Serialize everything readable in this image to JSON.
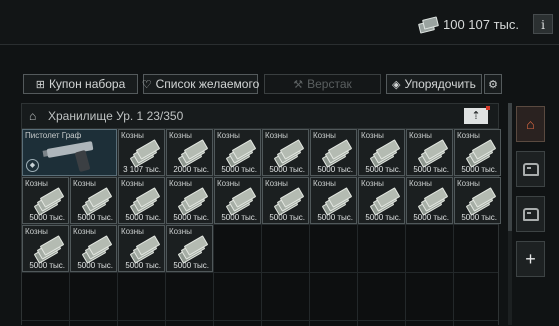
{
  "header": {
    "money_amount": "100 107 тыс.",
    "money_icon": "cash-icon",
    "info_label": "i"
  },
  "toolbar": {
    "preset_label": "Купон набора",
    "wishlist_label": "Список желаемого",
    "workbench_label": "Верстак",
    "sort_label": "Упорядочить",
    "preset_icon": "⊞",
    "wishlist_icon": "♡",
    "workbench_icon": "⚒",
    "sort_icon": "◈",
    "settings_icon": "⚙"
  },
  "storage": {
    "title": "Хранилище Ур. 1 23/350",
    "sort_icon": "⇡",
    "home_icon": "⌂"
  },
  "items": [
    {
      "name": "Пистолет Граф",
      "qty": "",
      "type": "pistol"
    },
    {
      "name": "Козны",
      "qty": "3 107 тыс.",
      "type": "cash"
    },
    {
      "name": "Козны",
      "qty": "2000 тыс.",
      "type": "cash"
    },
    {
      "name": "Козны",
      "qty": "5000 тыс.",
      "type": "cash"
    },
    {
      "name": "Козны",
      "qty": "5000 тыс.",
      "type": "cash"
    },
    {
      "name": "Козны",
      "qty": "5000 тыс.",
      "type": "cash"
    },
    {
      "name": "Козны",
      "qty": "5000 тыс.",
      "type": "cash"
    },
    {
      "name": "Козны",
      "qty": "5000 тыс.",
      "type": "cash"
    },
    {
      "name": "Козны",
      "qty": "5000 тыс.",
      "type": "cash"
    },
    {
      "name": "Козны",
      "qty": "5000 тыс.",
      "type": "cash"
    },
    {
      "name": "Козны",
      "qty": "5000 тыс.",
      "type": "cash"
    },
    {
      "name": "Козны",
      "qty": "5000 тыс.",
      "type": "cash"
    },
    {
      "name": "Козны",
      "qty": "5000 тыс.",
      "type": "cash"
    },
    {
      "name": "Козны",
      "qty": "5000 тыс.",
      "type": "cash"
    },
    {
      "name": "Козны",
      "qty": "5000 тыс.",
      "type": "cash"
    },
    {
      "name": "Козны",
      "qty": "5000 тыс.",
      "type": "cash"
    },
    {
      "name": "Козны",
      "qty": "5000 тыс.",
      "type": "cash"
    },
    {
      "name": "Козны",
      "qty": "5000 тыс.",
      "type": "cash"
    },
    {
      "name": "Козны",
      "qty": "5000 тыс.",
      "type": "cash"
    },
    {
      "name": "Козны",
      "qty": "5000 тыс.",
      "type": "cash"
    },
    {
      "name": "Козны",
      "qty": "5000 тыс.",
      "type": "cash"
    },
    {
      "name": "Козны",
      "qty": "5000 тыс.",
      "type": "cash"
    },
    {
      "name": "Козны",
      "qty": "5000 тыс.",
      "type": "cash"
    }
  ],
  "sidebar": {
    "buttons": [
      {
        "icon": "home-icon",
        "glyph": "⌂",
        "active": true
      },
      {
        "icon": "box-icon",
        "glyph": "",
        "active": false
      },
      {
        "icon": "box-icon",
        "glyph": "",
        "active": false
      },
      {
        "icon": "plus-icon",
        "glyph": "+",
        "active": false
      }
    ]
  }
}
